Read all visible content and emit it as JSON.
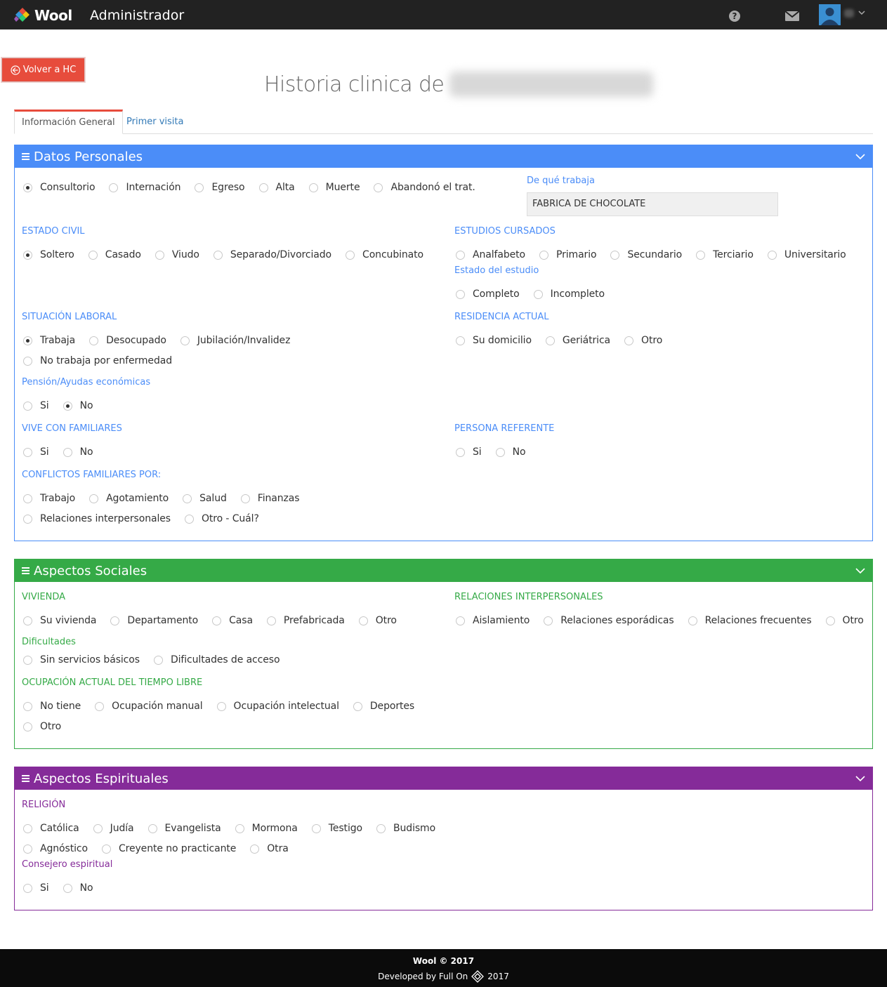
{
  "nav": {
    "brand": "Wool",
    "title": "Administrador",
    "help_icon": "question-circle-icon",
    "mail_icon": "envelope-icon",
    "avatar_icon": "user-avatar-icon"
  },
  "back_button": {
    "label": "Volver a HC",
    "icon": "arrow-circle-left-icon"
  },
  "page": {
    "title": "Historia clinica de"
  },
  "tabs": [
    {
      "label": "Información General",
      "active": true
    },
    {
      "label": "Primer visita",
      "active": false
    }
  ],
  "colors": {
    "accent_red": "#e74c3c",
    "blue": "#4b8df8",
    "green": "#35aa47",
    "purple": "#852b99",
    "navbar": "#222222"
  },
  "datos_personales": {
    "title": "Datos Personales",
    "situacion": {
      "options": [
        "Consultorio",
        "Internación",
        "Egreso",
        "Alta",
        "Muerte",
        "Abandonó el trat."
      ],
      "selected": "Consultorio"
    },
    "trabajo": {
      "label": "De qué trabaja",
      "value": "FABRICA DE CHOCOLATE"
    },
    "estado_civil": {
      "label": "ESTADO CIVIL",
      "options": [
        "Soltero",
        "Casado",
        "Viudo",
        "Separado/Divorciado",
        "Concubinato"
      ],
      "selected": "Soltero"
    },
    "estudios": {
      "label": "ESTUDIOS CURSADOS",
      "options": [
        "Analfabeto",
        "Primario",
        "Secundario",
        "Terciario",
        "Universitario"
      ]
    },
    "estado_estudio": {
      "label": "Estado del estudio",
      "options": [
        "Completo",
        "Incompleto"
      ]
    },
    "situacion_laboral": {
      "label": "SITUACIÓN LABORAL",
      "options": [
        "Trabaja",
        "Desocupado",
        "Jubilación/Invalidez",
        "No trabaja por enfermedad"
      ],
      "selected": "Trabaja"
    },
    "residencia": {
      "label": "RESIDENCIA ACTUAL",
      "options": [
        "Su domicilio",
        "Geriátrica",
        "Otro"
      ]
    },
    "pension": {
      "label": "Pensión/Ayudas económicas",
      "options": [
        "Si",
        "No"
      ],
      "selected": "No"
    },
    "vive_familiares": {
      "label": "VIVE CON FAMILIARES",
      "options": [
        "Si",
        "No"
      ]
    },
    "persona_referente": {
      "label": "PERSONA REFERENTE",
      "options": [
        "Si",
        "No"
      ]
    },
    "conflictos": {
      "label": "CONFLICTOS FAMILIARES POR:",
      "options": [
        "Trabajo",
        "Agotamiento",
        "Salud",
        "Finanzas",
        "Relaciones interpersonales",
        "Otro - Cuál?"
      ]
    }
  },
  "aspectos_sociales": {
    "title": "Aspectos Sociales",
    "vivienda": {
      "label": "VIVIENDA",
      "options": [
        "Su vivienda",
        "Departamento",
        "Casa",
        "Prefabricada",
        "Otro"
      ]
    },
    "relaciones": {
      "label": "RELACIONES INTERPERSONALES",
      "options": [
        "Aislamiento",
        "Relaciones esporádicas",
        "Relaciones frecuentes",
        "Otro"
      ]
    },
    "dificultades": {
      "label": "Dificultades",
      "options": [
        "Sin servicios básicos",
        "Dificultades de acceso"
      ]
    },
    "tiempo_libre": {
      "label": "OCUPACIÓN ACTUAL DEL TIEMPO LIBRE",
      "options": [
        "No tiene",
        "Ocupación manual",
        "Ocupación intelectual",
        "Deportes",
        "Otro"
      ]
    }
  },
  "aspectos_espirituales": {
    "title": "Aspectos Espirituales",
    "religion": {
      "label": "RELIGIÓN",
      "options": [
        "Católica",
        "Judía",
        "Evangelista",
        "Mormona",
        "Testigo",
        "Budismo",
        "Agnóstico",
        "Creyente no practicante",
        "Otra"
      ]
    },
    "consejero": {
      "label": "Consejero espiritual",
      "options": [
        "Si",
        "No"
      ]
    }
  },
  "footer": {
    "line1": "Wool © 2017",
    "line2_prefix": "Developed by Full On",
    "line2_year": "2017"
  }
}
